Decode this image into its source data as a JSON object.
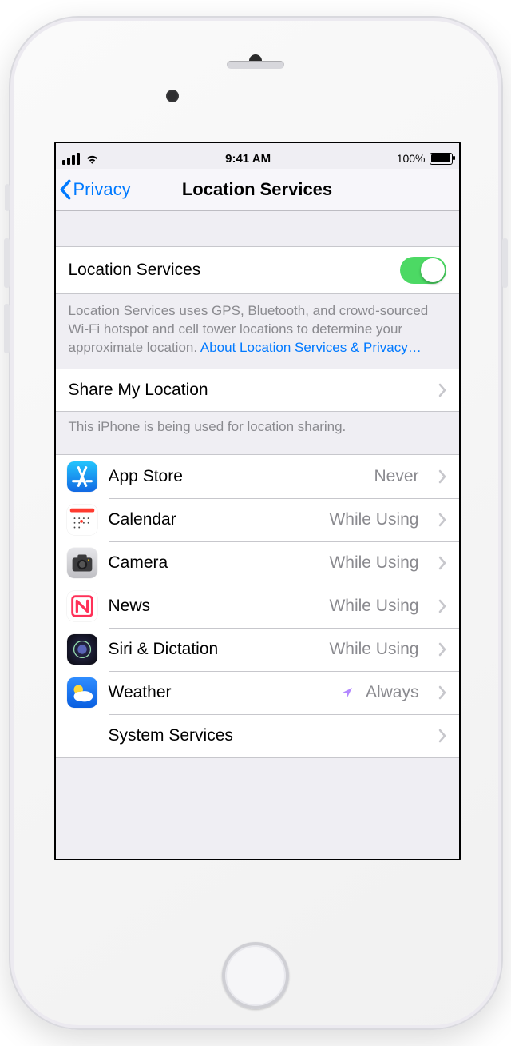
{
  "status": {
    "time": "9:41 AM",
    "battery_pct": "100%"
  },
  "nav": {
    "back_label": "Privacy",
    "title": "Location Services"
  },
  "master_toggle": {
    "label": "Location Services",
    "on": true
  },
  "toggle_footer": {
    "text": "Location Services uses GPS, Bluetooth, and crowd-sourced Wi-Fi hotspot and cell tower locations to determine your approximate location. ",
    "link_text": "About Location Services & Privacy…"
  },
  "share": {
    "label": "Share My Location",
    "footer": "This iPhone is being used for location sharing."
  },
  "apps": [
    {
      "id": "appstore",
      "name": "App Store",
      "value": "Never",
      "indicator": false
    },
    {
      "id": "calendar",
      "name": "Calendar",
      "value": "While Using",
      "indicator": false
    },
    {
      "id": "camera",
      "name": "Camera",
      "value": "While Using",
      "indicator": false
    },
    {
      "id": "news",
      "name": "News",
      "value": "While Using",
      "indicator": false
    },
    {
      "id": "siri",
      "name": "Siri & Dictation",
      "value": "While Using",
      "indicator": false
    },
    {
      "id": "weather",
      "name": "Weather",
      "value": "Always",
      "indicator": true
    }
  ],
  "system_services": {
    "label": "System Services"
  }
}
